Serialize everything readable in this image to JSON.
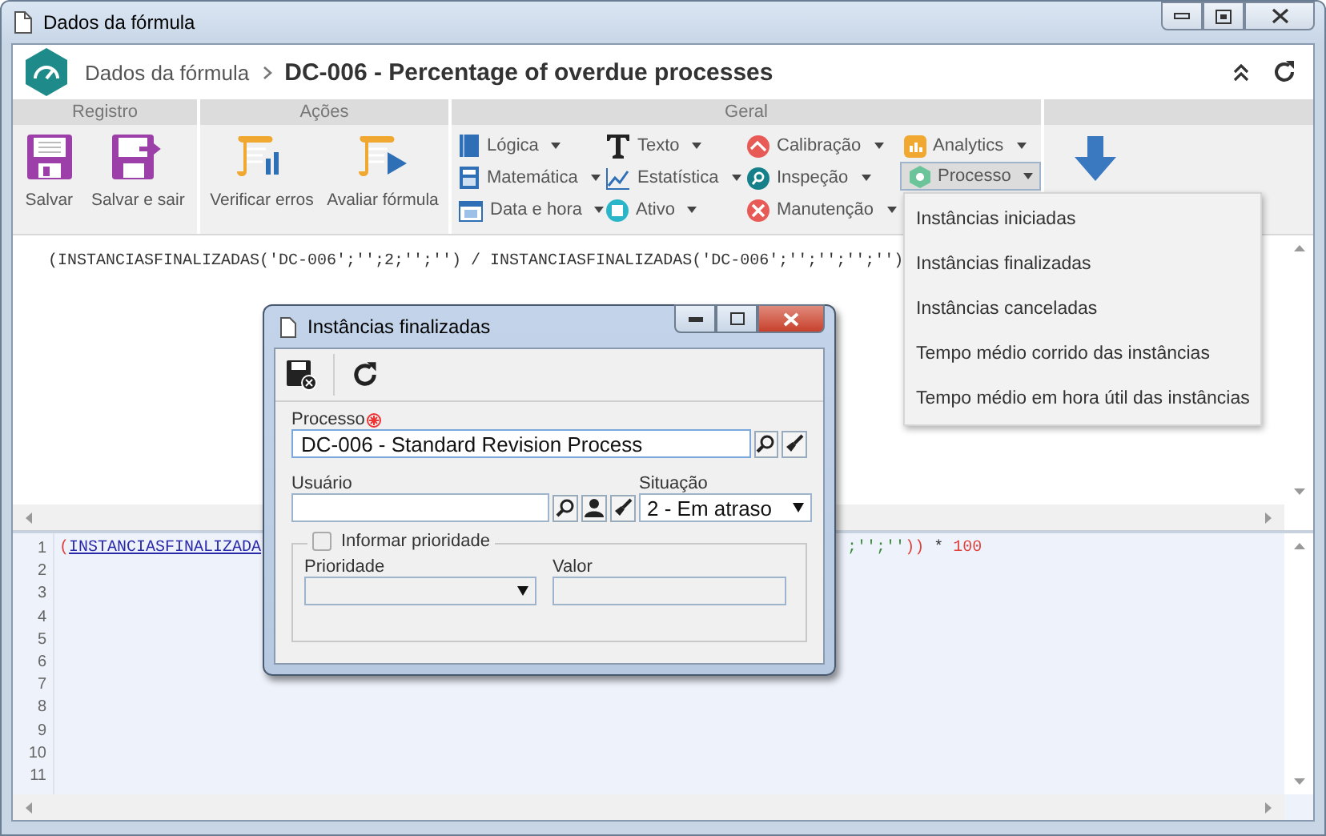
{
  "window": {
    "title": "Dados da fórmula"
  },
  "header": {
    "breadcrumb": "Dados da fórmula",
    "title": "DC-006 - Percentage of overdue processes"
  },
  "ribbon": {
    "groups": [
      {
        "kind": "large",
        "label": "Registro",
        "buttons": [
          {
            "label": "Salvar",
            "kind": "save"
          },
          {
            "label": "Salvar e sair",
            "kind": "save-exit"
          }
        ]
      },
      {
        "kind": "large",
        "label": "Ações",
        "buttons": [
          {
            "label": "Verificar erros",
            "kind": "check"
          },
          {
            "label": "Avaliar fórmula",
            "kind": "evaluate"
          }
        ]
      },
      {
        "kind": "menus",
        "label": "Geral",
        "columns": [
          [
            {
              "label": "Lógica",
              "kind": "book",
              "selected": false
            },
            {
              "label": "Matemática",
              "kind": "calculator",
              "selected": false
            },
            {
              "label": "Data e hora",
              "kind": "calendar",
              "selected": false
            }
          ],
          [
            {
              "label": "Texto",
              "kind": "text",
              "selected": false
            },
            {
              "label": "Estatística",
              "kind": "chart",
              "selected": false
            },
            {
              "label": "Ativo",
              "kind": "asset",
              "selected": false
            }
          ],
          [
            {
              "label": "Calibração",
              "kind": "calibration",
              "selected": false
            },
            {
              "label": "Inspeção",
              "kind": "inspection",
              "selected": false
            },
            {
              "label": "Manutenção",
              "kind": "maintenance",
              "selected": false
            }
          ],
          [
            {
              "label": "Analytics",
              "kind": "analytics",
              "selected": false
            },
            {
              "label": "Processo",
              "kind": "process",
              "selected": true
            }
          ]
        ]
      },
      {
        "kind": "arrow"
      }
    ]
  },
  "formula": {
    "text": "(INSTANCIASFINALIZADAS('DC-006';'';2;'';'') / INSTANCIASFINALIZADAS('DC-006';'';'';'';'')"
  },
  "code_editor": {
    "line_numbers": [
      "1",
      "2",
      "3",
      "4",
      "5",
      "6",
      "7",
      "8",
      "9",
      "10",
      "11"
    ],
    "line_start": [
      {
        "text": "(",
        "kind": "paren"
      },
      {
        "text": "INSTANCIASFINALIZADA",
        "kind": "function"
      }
    ],
    "line_end": [
      {
        "text": ";'';''",
        "kind": "string"
      },
      {
        "text": "))",
        "kind": "paren"
      },
      {
        "text": " * ",
        "kind": "operator"
      },
      {
        "text": "100",
        "kind": "number"
      }
    ]
  },
  "menu": {
    "items": [
      "Instâncias iniciadas",
      "Instâncias finalizadas",
      "Instâncias canceladas",
      "Tempo médio corrido das instâncias",
      "Tempo médio em hora útil das instâncias"
    ]
  },
  "dialog": {
    "title": "Instâncias finalizadas",
    "process": {
      "label": "Processo",
      "required": true,
      "value": "DC-006 - Standard Revision Process"
    },
    "user": {
      "label": "Usuário"
    },
    "status": {
      "label": "Situação",
      "value": "2 - Em atraso"
    },
    "priority_group": {
      "label": "Informar prioridade",
      "checked": false
    },
    "priority": {
      "label": "Prioridade"
    },
    "value": {
      "label": "Valor"
    }
  }
}
